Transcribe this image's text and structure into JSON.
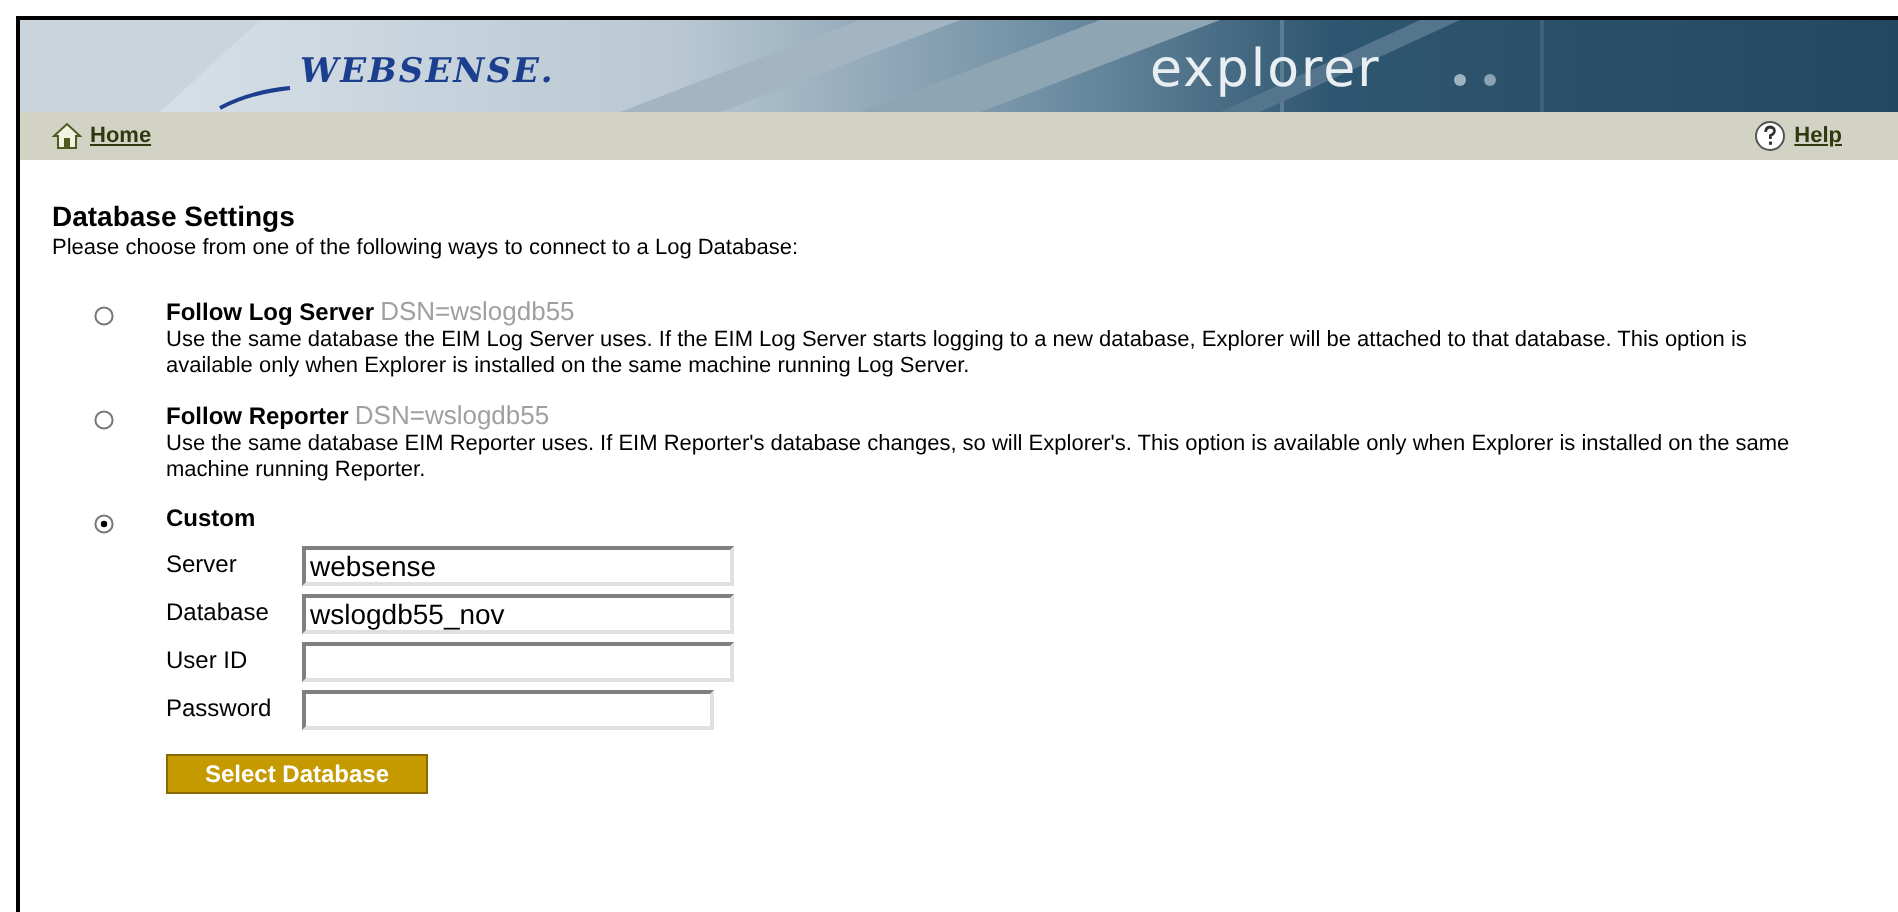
{
  "banner": {
    "logo": "WEBSENSE.",
    "product": "explorer"
  },
  "nav": {
    "home": "Home",
    "help": "Help"
  },
  "heading": "Database Settings",
  "intro": "Please choose from one of the following ways to connect to a Log Database:",
  "options": [
    {
      "label": "Follow Log Server",
      "dsn": "DSN=wslogdb55",
      "description": "Use the same database the EIM Log Server uses. If the EIM Log Server starts logging to a new database, Explorer will be attached to that database. This option is available only when Explorer is installed on the same machine running Log Server.",
      "selected": false
    },
    {
      "label": "Follow Reporter",
      "dsn": "DSN=wslogdb55",
      "description": "Use the same database EIM Reporter uses. If EIM Reporter's database changes, so will Explorer's. This option is available only when Explorer is installed on the same machine running Reporter.",
      "selected": false
    },
    {
      "label": "Custom",
      "selected": true,
      "fields": [
        {
          "label": "Server",
          "value": "websense",
          "kind": "text"
        },
        {
          "label": "Database",
          "value": "wslogdb55_nov",
          "kind": "text"
        },
        {
          "label": "User ID",
          "kind": "text"
        },
        {
          "label": "Password",
          "kind": "password"
        }
      ],
      "button": "Select Database"
    }
  ]
}
